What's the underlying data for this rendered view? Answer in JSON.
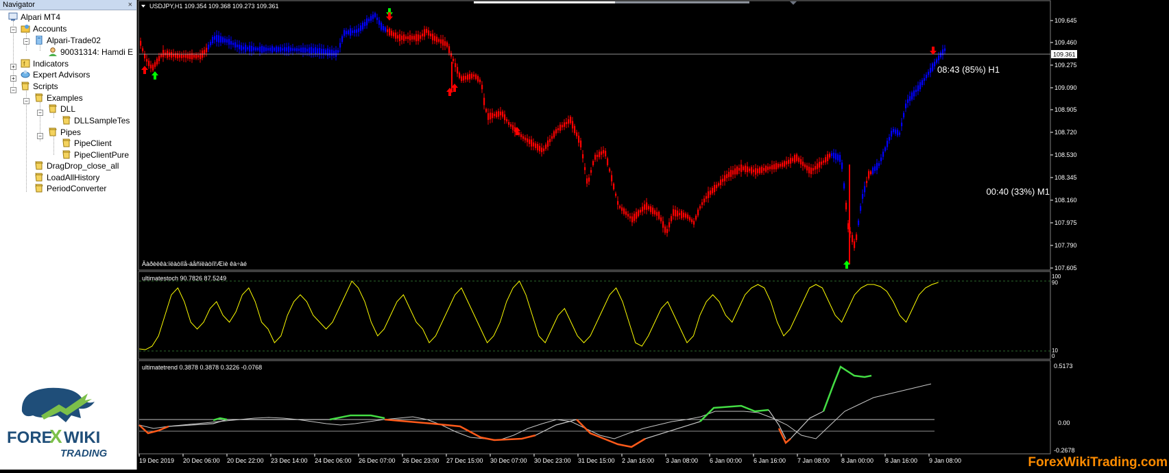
{
  "navigator": {
    "title": "Navigator",
    "close": "×",
    "items": [
      {
        "label": "Alpari MT4"
      },
      {
        "label": "Accounts"
      },
      {
        "label": "Alpari-Trade02"
      },
      {
        "label": "90031314: Hamdi E"
      },
      {
        "label": "Indicators"
      },
      {
        "label": "Expert Advisors"
      },
      {
        "label": "Scripts"
      },
      {
        "label": "Examples"
      },
      {
        "label": "DLL"
      },
      {
        "label": "DLLSampleTes"
      },
      {
        "label": "Pipes"
      },
      {
        "label": "PipeClient"
      },
      {
        "label": "PipeClientPure"
      },
      {
        "label": "DragDrop_close_all"
      },
      {
        "label": "LoadAllHistory"
      },
      {
        "label": "PeriodConverter"
      }
    ]
  },
  "logo": {
    "brand_a": "FORE",
    "brand_x": "X",
    "brand_b": "WIKI",
    "sub": "TRADING"
  },
  "main_chart": {
    "header": "USDJPY,H1  109.354 109.368 109.273 109.361",
    "price_label": "109.361",
    "timer_h1": "08:43 (85%) H1",
    "timer_m1": "00:40 (33%) M1",
    "bottom_text": "Äàðèëêà:ïëàòíîå-áåñïëàòíî!Æìè êà÷àé",
    "price_ticks": [
      "109.645",
      "109.460",
      "109.275",
      "109.090",
      "108.905",
      "108.720",
      "108.530",
      "108.345",
      "108.160",
      "107.975",
      "107.790",
      "107.605"
    ],
    "bull_color": "#0000ff",
    "bear_color": "#ff0000"
  },
  "stoch": {
    "header": "ultimatestoch 90.7826 87.5249",
    "ticks": [
      "100",
      "90",
      "10",
      "0"
    ],
    "line_color": "#ffff00"
  },
  "trend": {
    "header": "ultimatetrend 0.3878 0.3878 0.3226 -0.0768",
    "ticks": [
      "0.5173",
      "0.00",
      "-0.2678"
    ]
  },
  "time_axis": [
    "19 Dec 2019",
    "20 Dec 06:00",
    "20 Dec 22:00",
    "23 Dec 14:00",
    "24 Dec 06:00",
    "26 Dec 07:00",
    "26 Dec 23:00",
    "27 Dec 15:00",
    "30 Dec 07:00",
    "30 Dec 23:00",
    "31 Dec 15:00",
    "2 Jan 16:00",
    "3 Jan 08:00",
    "6 Jan 00:00",
    "6 Jan 16:00",
    "7 Jan 08:00",
    "8 Jan 00:00",
    "8 Jan 16:00",
    "9 Jan 08:00"
  ],
  "watermark": "ForexWikiTrading.com"
}
